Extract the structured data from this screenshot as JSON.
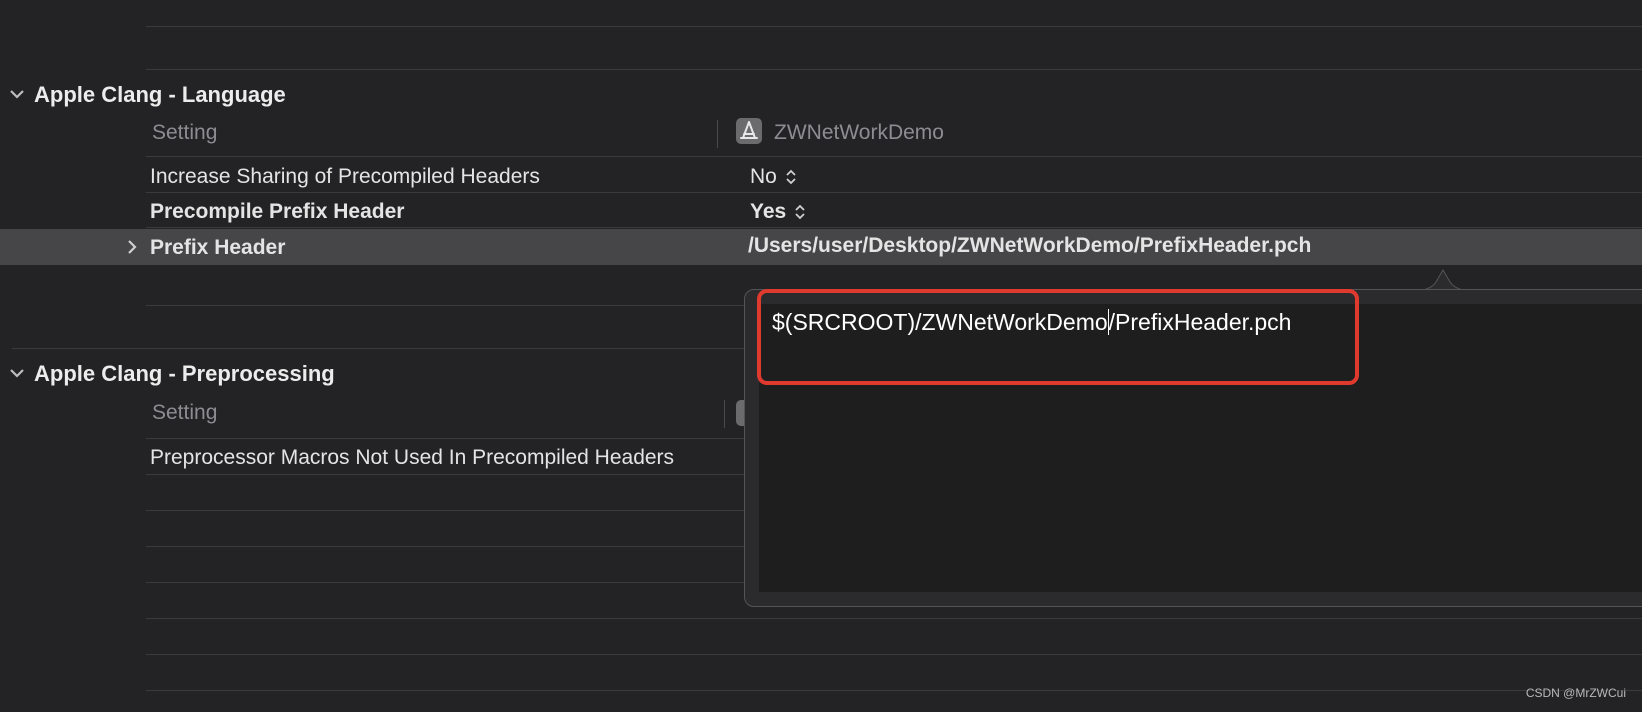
{
  "sections": [
    {
      "title": "Apple Clang - Language",
      "columns": {
        "setting": "Setting",
        "target": "ZWNetWorkDemo"
      },
      "rows": [
        {
          "label": "Increase Sharing of Precompiled Headers",
          "value": "No"
        },
        {
          "label": "Precompile Prefix Header",
          "value": "Yes"
        },
        {
          "label": "Prefix Header",
          "value": "/Users/user/Desktop/ZWNetWorkDemo/PrefixHeader.pch"
        }
      ]
    },
    {
      "title": "Apple Clang - Preprocessing",
      "columns": {
        "setting": "Setting"
      },
      "rows": [
        {
          "label": "Preprocessor Macros Not Used In Precompiled Headers"
        }
      ]
    }
  ],
  "popover": {
    "text_before_caret": "$(SRCROOT)/ZWNetWorkDemo",
    "text_after_caret": "/PrefixHeader.pch"
  },
  "watermark": "CSDN @MrZWCui",
  "colors": {
    "highlight": "#e03a2e",
    "background": "#232325",
    "selected_row": "#464648"
  },
  "icons": {
    "target": "app-target-icon",
    "expand": "chevron-right-icon",
    "collapse": "chevron-down-icon",
    "stepper": "up-down-stepper-icon"
  }
}
